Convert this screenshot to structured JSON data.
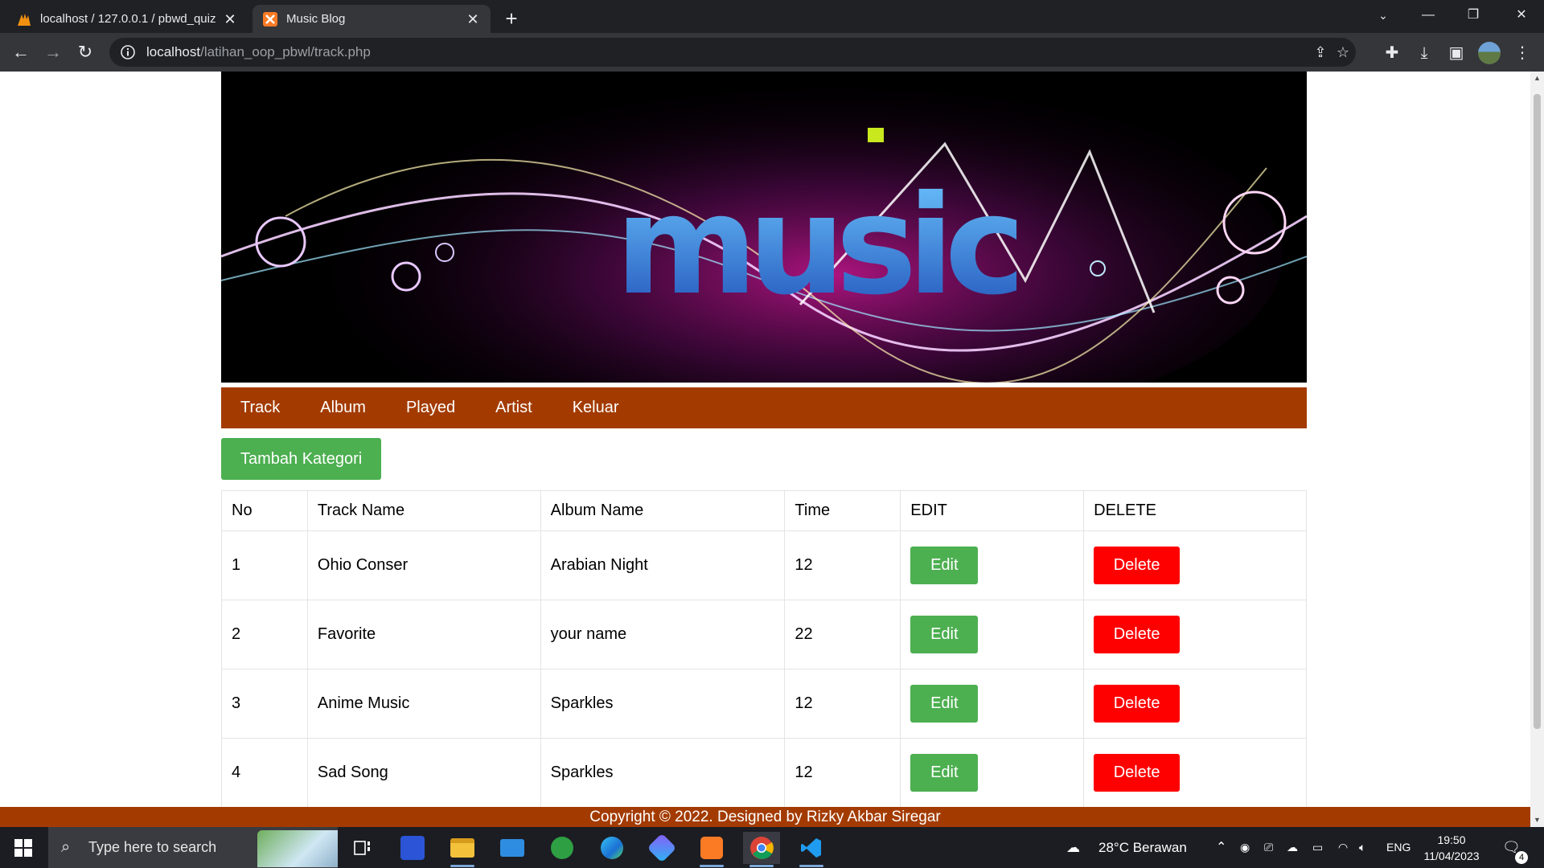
{
  "browser": {
    "tabs": [
      {
        "title": "localhost / 127.0.0.1 / pbwd_quiz",
        "active": false
      },
      {
        "title": "Music Blog",
        "active": true
      }
    ],
    "new_tab": "+",
    "url": {
      "host": "localhost",
      "path": "/latihan_oop_pbwl/track.php"
    }
  },
  "banner": {
    "word": "music",
    "accent": "#ff40c0"
  },
  "nav": {
    "items": [
      "Track",
      "Album",
      "Played",
      "Artist",
      "Keluar"
    ],
    "color": "#a33b00"
  },
  "actions": {
    "add_label": "Tambah Kategori"
  },
  "table": {
    "headers": [
      "No",
      "Track Name",
      "Album Name",
      "Time",
      "EDIT",
      "DELETE"
    ],
    "rows": [
      {
        "no": "1",
        "track": "Ohio Conser",
        "album": "Arabian Night",
        "time": "12",
        "edit": "Edit",
        "delete": "Delete"
      },
      {
        "no": "2",
        "track": "Favorite",
        "album": "your name",
        "time": "22",
        "edit": "Edit",
        "delete": "Delete"
      },
      {
        "no": "3",
        "track": "Anime Music",
        "album": "Sparkles",
        "time": "12",
        "edit": "Edit",
        "delete": "Delete"
      },
      {
        "no": "4",
        "track": "Sad Song",
        "album": "Sparkles",
        "time": "12",
        "edit": "Edit",
        "delete": "Delete"
      }
    ]
  },
  "footer": {
    "text": "Copyright © 2022. Designed by Rizky Akbar Siregar"
  },
  "taskbar": {
    "search_placeholder": "Type here to search",
    "weather": "28°C  Berawan",
    "lang": "ENG",
    "time": "19:50",
    "date": "11/04/2023",
    "notifications": "4"
  }
}
